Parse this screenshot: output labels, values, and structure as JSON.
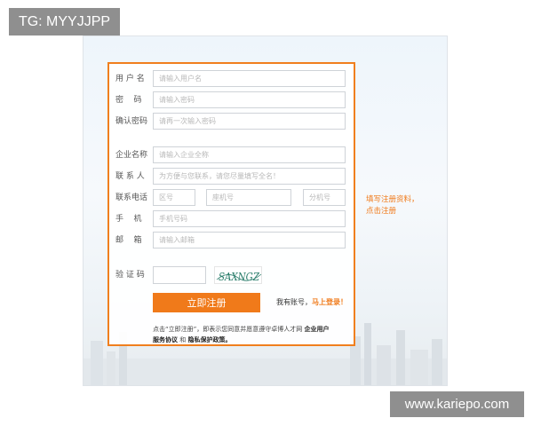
{
  "watermarks": {
    "top_left": "TG: MYYJJPP",
    "bottom_right": "www.kariepo.com"
  },
  "form": {
    "username": {
      "label": "用 户 名",
      "placeholder": "请输入用户名"
    },
    "password": {
      "label": "密    码",
      "placeholder": "请输入密码"
    },
    "confirm_password": {
      "label": "确认密码",
      "placeholder": "请再一次输入密码"
    },
    "company": {
      "label": "企业名称",
      "placeholder": "请输入企业全称"
    },
    "contact": {
      "label": "联 系 人",
      "placeholder": "为方便与您联系，请您尽量填写全名！"
    },
    "phone": {
      "label": "联系电话",
      "area_placeholder": "区号",
      "main_placeholder": "座机号",
      "ext_placeholder": "分机号"
    },
    "mobile": {
      "label": "手    机",
      "placeholder": "手机号码"
    },
    "email": {
      "label": "邮    箱",
      "placeholder": "请输入邮箱"
    },
    "captcha": {
      "label": "验 证 码",
      "image_text": "SAXNGZ"
    }
  },
  "actions": {
    "register_button": "立即注册",
    "have_account": "我有账号，",
    "login_link": "马上登录！"
  },
  "agreement": {
    "prefix": "点击“立即注册”，即表示您同意并愿意遵守卓博人才网",
    "enterprise_user": "企业用户",
    "service_agreement": "服务协议",
    "and": "和",
    "privacy_policy": "隐私保护政策。"
  },
  "side_tip": {
    "line1": "填写注册资料，",
    "line2": "点击注册"
  },
  "colors": {
    "accent": "#f07a1a",
    "panel_border": "#f07f1e",
    "captcha_text": "#2a7d6b"
  }
}
